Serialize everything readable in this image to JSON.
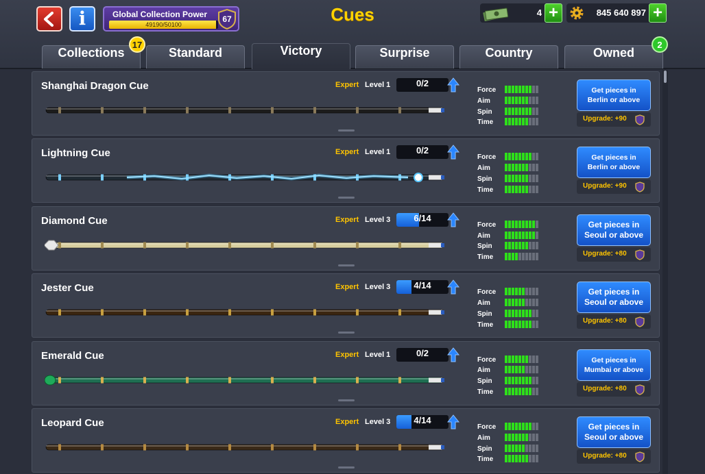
{
  "header": {
    "title": "Cues",
    "global_power_label": "Global Collection Power",
    "global_power_value": "49190/50100",
    "global_power_progress": 0.982,
    "global_power_level": "67",
    "cash": "4",
    "coins": "845 640 897"
  },
  "tabs": [
    {
      "label": "Collections",
      "badge": "17"
    },
    {
      "label": "Standard"
    },
    {
      "label": "Victory"
    },
    {
      "label": "Surprise"
    },
    {
      "label": "Country"
    },
    {
      "label": "Owned",
      "badge": "2"
    }
  ],
  "stat_labels": {
    "force": "Force",
    "aim": "Aim",
    "spin": "Spin",
    "time": "Time"
  },
  "cues": [
    {
      "name": "Shanghai Dragon Cue",
      "expert": "Expert",
      "level": "Level 1",
      "pieces": "0/2",
      "progress": 0,
      "stats": [
        8,
        7,
        8,
        7
      ],
      "button": "Get pieces in Berlin or above",
      "upgrade": "Upgrade: +90"
    },
    {
      "name": "Lightning Cue",
      "expert": "Expert",
      "level": "Level 1",
      "pieces": "0/2",
      "progress": 0,
      "stats": [
        8,
        7,
        7,
        7
      ],
      "button": "Get pieces in Berlin or above",
      "upgrade": "Upgrade: +90"
    },
    {
      "name": "Diamond Cue",
      "expert": "Expert",
      "level": "Level 3",
      "pieces": "6/14",
      "progress": 0.43,
      "stats": [
        9,
        9,
        7,
        4
      ],
      "button": "Get pieces in Seoul or above",
      "upgrade": "Upgrade: +80"
    },
    {
      "name": "Jester Cue",
      "expert": "Expert",
      "level": "Level 3",
      "pieces": "4/14",
      "progress": 0.29,
      "stats": [
        6,
        6,
        8,
        8
      ],
      "button": "Get pieces in Seoul or above",
      "upgrade": "Upgrade: +80"
    },
    {
      "name": "Emerald Cue",
      "expert": "Expert",
      "level": "Level 1",
      "pieces": "0/2",
      "progress": 0,
      "stats": [
        7,
        6,
        8,
        8
      ],
      "button": "Get pieces in Mumbai or above",
      "upgrade": "Upgrade: +80"
    },
    {
      "name": "Leopard Cue",
      "expert": "Expert",
      "level": "Level 3",
      "pieces": "4/14",
      "progress": 0.29,
      "stats": [
        8,
        7,
        6,
        7
      ],
      "button": "Get pieces in Seoul or above",
      "upgrade": "Upgrade: +80"
    }
  ],
  "colors": {
    "title": "#ffd200",
    "expert": "#ffc400",
    "stat_on": "#2ee01a",
    "button": "#1f6fe6"
  }
}
